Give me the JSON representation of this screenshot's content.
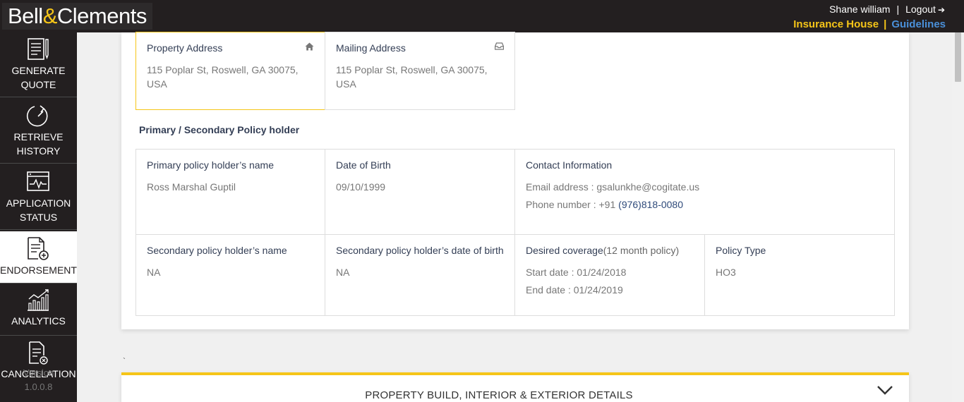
{
  "header": {
    "logo_left": "Bell",
    "logo_amp": "&",
    "logo_right": "Clements",
    "user_name": "Shane william",
    "separator": "|",
    "logout_label": "Logout",
    "insurance_house": "Insurance House",
    "guidelines": "Guidelines"
  },
  "sidebar": {
    "items": [
      {
        "label_line1": "GENERATE",
        "label_line2": "QUOTE",
        "icon": "generate-quote-icon"
      },
      {
        "label_line1": "RETRIEVE",
        "label_line2": "HISTORY",
        "icon": "retrieve-history-icon"
      },
      {
        "label_line1": "APPLICATION",
        "label_line2": "STATUS",
        "icon": "application-status-icon"
      },
      {
        "label_line1": "ENDORSEMENT",
        "icon": "endorsement-icon"
      },
      {
        "label_line1": "ANALYTICS",
        "icon": "analytics-icon"
      },
      {
        "label_line1": "CANCELLATION",
        "icon": "cancellation-icon"
      }
    ],
    "version_line1": "Version",
    "version_line2": "1.0.0.8",
    "active_index": 3
  },
  "address": {
    "property_title": "Property Address",
    "property_value": "115 Poplar St, Roswell, GA 30075, USA",
    "mailing_title": "Mailing Address",
    "mailing_value": "115 Poplar St, Roswell, GA 30075, USA"
  },
  "policyholder": {
    "heading": "Primary / Secondary Policy holder",
    "primary_name_label": "Primary policy holder’s name",
    "primary_name_value": "Ross Marshal Guptil",
    "dob_label": "Date of Birth",
    "dob_value": "09/10/1999",
    "contact_label": "Contact Information",
    "email_text": "Email address : gsalunkhe@cogitate.us",
    "phone_prefix": "Phone number : +91 ",
    "phone_number": "(976)818-0080",
    "secondary_name_label": "Secondary policy holder’s name",
    "secondary_name_value": "NA",
    "secondary_dob_label": "Secondary policy holder’s date of birth",
    "secondary_dob_value": "NA",
    "coverage_label": "Desired coverage",
    "coverage_sub": "(12 month policy)",
    "start_date": "Start date : 01/24/2018",
    "end_date": "End date : 01/24/2019",
    "policy_type_label": "Policy Type",
    "policy_type_value": "HO3"
  },
  "misc": {
    "stray_mark": "`"
  },
  "accordion": {
    "title": "PROPERTY BUILD, INTERIOR & EXTERIOR DETAILS"
  },
  "colors": {
    "accent_yellow": "#f5c518",
    "link_blue": "#4a90d9",
    "dark": "#231f20"
  }
}
